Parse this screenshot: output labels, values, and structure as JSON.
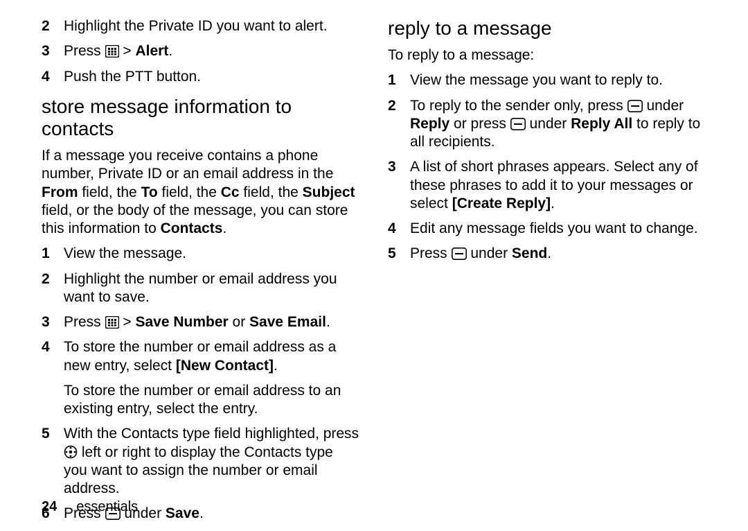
{
  "topList": [
    {
      "n": "2",
      "t": "Highlight the Private ID you want to alert."
    },
    {
      "n": "3",
      "pre": "Press ",
      "icon": "menu",
      "after": " > ",
      "bold": "Alert",
      "post": "."
    },
    {
      "n": "4",
      "t": "Push the PTT button."
    }
  ],
  "sec1": {
    "title": "store message information to contacts",
    "intro_parts": {
      "a": "If a message you receive contains a phone number, Private ID or an email address in the ",
      "from": "From",
      "b": " field, the ",
      "to": "To",
      "c": " field, the ",
      "cc": "Cc",
      "d": " field, the ",
      "subject": "Subject",
      "e": " field, or the body of the message, you can store this information to ",
      "contacts": "Contacts",
      "f": "."
    },
    "steps": {
      "s1": "View the message.",
      "s2": "Highlight the number or email address you want to save.",
      "s3_pre": "Press ",
      "s3_mid": " > ",
      "s3_b1": "Save Number",
      "s3_or": " or ",
      "s3_b2": "Save Email",
      "s3_post": ".",
      "s4a": "To store the number or email address as a new entry, select ",
      "s4b": "[New Contact]",
      "s4c": ".",
      "s4sub": "To store the number or email address to an existing entry, select the entry.",
      "s5a": "With the Contacts type field highlighted, press ",
      "s5b": " left or right to display the Contacts type you want to assign the number or email address.",
      "s6a": "Press ",
      "s6b": " under ",
      "s6c": "Save",
      "s6d": "."
    }
  },
  "sec2": {
    "title": "reply to a message",
    "intro": "To reply to a message:",
    "s1": "View the message you want to reply to.",
    "s2a": "To reply to the sender only, press ",
    "s2b": " under ",
    "s2c": "Reply",
    "s2d": " or press ",
    "s2e": " under ",
    "s2f": "Reply All",
    "s2g": " to reply to all recipients.",
    "s3a": "A list of short phrases appears. Select any of these phrases to add it to your messages or select ",
    "s3b": "[Create Reply]",
    "s3c": ".",
    "s4": "Edit any message fields you want to change.",
    "s5a": "Press ",
    "s5b": " under ",
    "s5c": "Send",
    "s5d": "."
  },
  "footer": {
    "page": "24",
    "section": "essentials"
  }
}
